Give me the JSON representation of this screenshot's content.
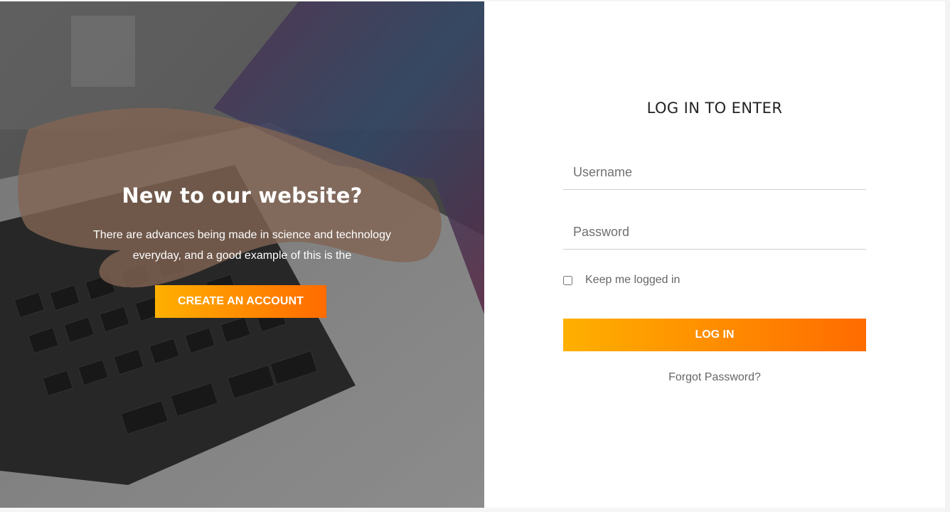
{
  "hero": {
    "title": "New to our website?",
    "text": "There are advances being made in science and technology everyday, and a good example of this is the",
    "create_button": "CREATE AN ACCOUNT",
    "photo_icon": "laptop-typing-photo"
  },
  "login": {
    "title": "LOG IN TO ENTER",
    "username_placeholder": "Username",
    "username_value": "",
    "password_placeholder": "Password",
    "password_value": "",
    "remember_label": "Keep me logged in",
    "remember_checked": false,
    "login_button": "LOG IN",
    "forgot_link": "Forgot Password?"
  },
  "colors": {
    "accent_start": "#ffb000",
    "accent_end": "#ff6b00",
    "panel_bg": "#ffffff"
  }
}
